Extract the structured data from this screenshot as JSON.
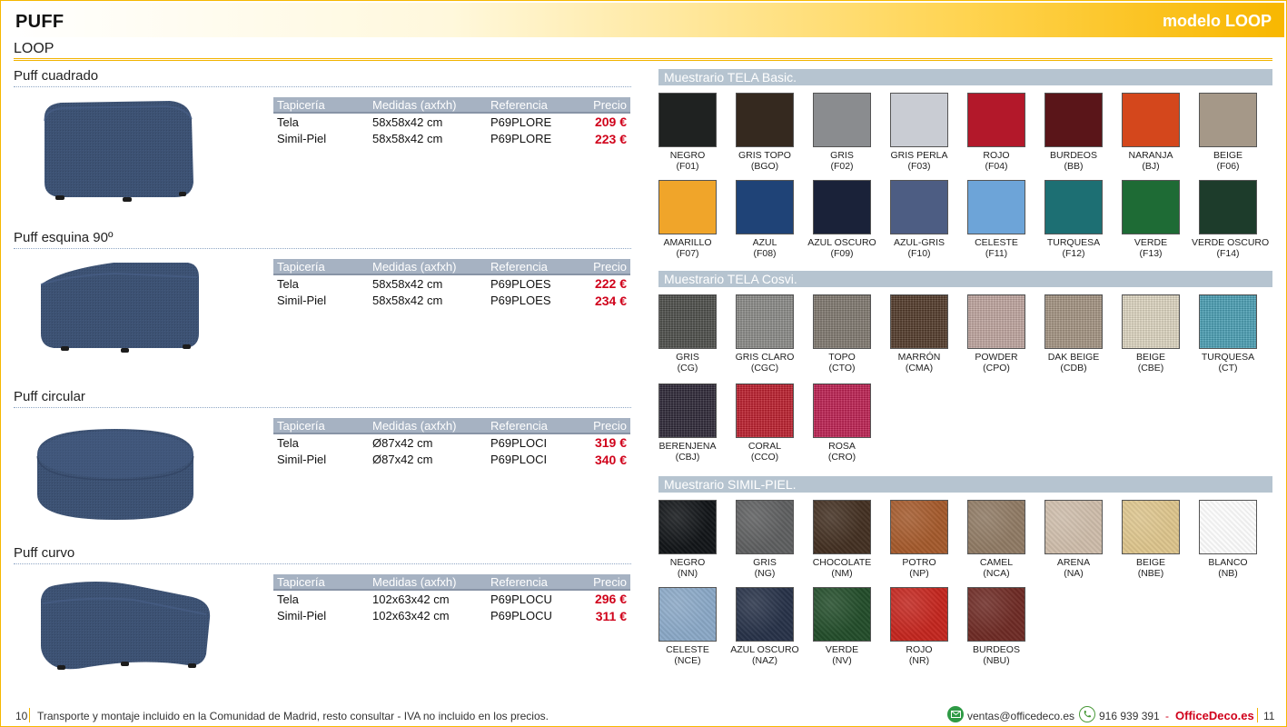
{
  "header": {
    "title": "PUFF",
    "model": "modelo LOOP",
    "subtitle": "LOOP"
  },
  "table_headers": {
    "tapiceria": "Tapicería",
    "medidas": "Medidas (axfxh)",
    "referencia": "Referencia",
    "precio": "Precio"
  },
  "products": [
    {
      "name": "Puff cuadrado",
      "shape": "square",
      "rows": [
        {
          "tapiceria": "Tela",
          "medidas": "58x58x42 cm",
          "referencia": "P69PLORE",
          "precio": "209 €"
        },
        {
          "tapiceria": "Simil-Piel",
          "medidas": "58x58x42 cm",
          "referencia": "P69PLORE",
          "precio": "223 €"
        }
      ]
    },
    {
      "name": "Puff esquina 90º",
      "shape": "corner",
      "rows": [
        {
          "tapiceria": "Tela",
          "medidas": "58x58x42 cm",
          "referencia": "P69PLOES",
          "precio": "222 €"
        },
        {
          "tapiceria": "Simil-Piel",
          "medidas": "58x58x42 cm",
          "referencia": "P69PLOES",
          "precio": "234 €"
        }
      ]
    },
    {
      "name": "Puff circular",
      "shape": "round",
      "rows": [
        {
          "tapiceria": "Tela",
          "medidas": "Ø87x42 cm",
          "referencia": "P69PLOCI",
          "precio": "319 €"
        },
        {
          "tapiceria": "Simil-Piel",
          "medidas": "Ø87x42 cm",
          "referencia": "P69PLOCI",
          "precio": "340 €"
        }
      ]
    },
    {
      "name": "Puff curvo",
      "shape": "curved",
      "rows": [
        {
          "tapiceria": "Tela",
          "medidas": "102x63x42 cm",
          "referencia": "P69PLOCU",
          "precio": "296 €"
        },
        {
          "tapiceria": "Simil-Piel",
          "medidas": "102x63x42 cm",
          "referencia": "P69PLOCU",
          "precio": "311 €"
        }
      ]
    }
  ],
  "swatch_sections": [
    {
      "title": "Muestrario TELA Basic.",
      "texture": "flat",
      "swatches": [
        {
          "name": "NEGRO",
          "code": "(F01)",
          "color": "#1f2221"
        },
        {
          "name": "GRIS TOPO",
          "code": "(BGO)",
          "color": "#35291f"
        },
        {
          "name": "GRIS",
          "code": "(F02)",
          "color": "#8a8c8f"
        },
        {
          "name": "GRIS PERLA",
          "code": "(F03)",
          "color": "#c9ccd3"
        },
        {
          "name": "ROJO",
          "code": "(F04)",
          "color": "#b3182a"
        },
        {
          "name": "BURDEOS",
          "code": "(BB)",
          "color": "#5a1519"
        },
        {
          "name": "NARANJA",
          "code": "(BJ)",
          "color": "#d4471c"
        },
        {
          "name": "BEIGE",
          "code": "(F06)",
          "color": "#a59888"
        },
        {
          "name": "AMARILLO",
          "code": "(F07)",
          "color": "#f0a52a"
        },
        {
          "name": "AZUL",
          "code": "(F08)",
          "color": "#1f4377"
        },
        {
          "name": "AZUL OSCURO",
          "code": "(F09)",
          "color": "#1a2239"
        },
        {
          "name": "AZUL-GRIS",
          "code": "(F10)",
          "color": "#4d5d83"
        },
        {
          "name": "CELESTE",
          "code": "(F11)",
          "color": "#6da4d8"
        },
        {
          "name": "TURQUESA",
          "code": "(F12)",
          "color": "#1d6f73"
        },
        {
          "name": "VERDE",
          "code": "(F13)",
          "color": "#1e6b35"
        },
        {
          "name": "VERDE OSCURO",
          "code": "(F14)",
          "color": "#1d3c2b"
        }
      ]
    },
    {
      "title": "Muestrario TELA Cosvi.",
      "texture": "tex",
      "swatches": [
        {
          "name": "GRIS",
          "code": "(CG)",
          "color": "#4d4e4a"
        },
        {
          "name": "GRIS CLARO",
          "code": "(CGC)",
          "color": "#8d8d8a"
        },
        {
          "name": "TOPO",
          "code": "(CTO)",
          "color": "#827a71"
        },
        {
          "name": "MARRÓN",
          "code": "(CMA)",
          "color": "#533a29"
        },
        {
          "name": "POWDER",
          "code": "(CPO)",
          "color": "#c4a9a3"
        },
        {
          "name": "DAK BEIGE",
          "code": "(CDB)",
          "color": "#a89784"
        },
        {
          "name": "BEIGE",
          "code": "(CBE)",
          "color": "#e4dcc6"
        },
        {
          "name": "TURQUESA",
          "code": "(CT)",
          "color": "#4ba3b8"
        },
        {
          "name": "BERENJENA",
          "code": "(CBJ)",
          "color": "#2c2636"
        },
        {
          "name": "CORAL",
          "code": "(CCO)",
          "color": "#c11d2c"
        },
        {
          "name": "ROSA",
          "code": "(CRO)",
          "color": "#c21f52"
        }
      ]
    },
    {
      "title": "Muestrario SIMIL-PIEL.",
      "texture": "leather",
      "swatches": [
        {
          "name": "NEGRO",
          "code": "(NN)",
          "color": "#121518"
        },
        {
          "name": "GRIS",
          "code": "(NG)",
          "color": "#5e5f60"
        },
        {
          "name": "CHOCOLATE",
          "code": "(NM)",
          "color": "#433022"
        },
        {
          "name": "POTRO",
          "code": "(NP)",
          "color": "#a45a2c"
        },
        {
          "name": "CAMEL",
          "code": "(NCA)",
          "color": "#8f7a64"
        },
        {
          "name": "ARENA",
          "code": "(NA)",
          "color": "#cdbcaa"
        },
        {
          "name": "BEIGE",
          "code": "(NBE)",
          "color": "#dcc48c"
        },
        {
          "name": "BLANCO",
          "code": "(NB)",
          "color": "#fbfbfb"
        },
        {
          "name": "CELESTE",
          "code": "(NCE)",
          "color": "#8aa8c6"
        },
        {
          "name": "AZUL OSCURO",
          "code": "(NAZ)",
          "color": "#273248"
        },
        {
          "name": "VERDE",
          "code": "(NV)",
          "color": "#234d2a"
        },
        {
          "name": "ROJO",
          "code": "(NR)",
          "color": "#c3261f"
        },
        {
          "name": "BURDEOS",
          "code": "(NBU)",
          "color": "#6e2b25"
        }
      ]
    }
  ],
  "footer": {
    "page_left": "10",
    "note": "Transporte y montaje incluido en la Comunidad de Madrid, resto consultar - IVA no incluido en los precios.",
    "email": "ventas@officedeco.es",
    "phone": "916 939 391",
    "separator": "-",
    "site": "OfficeDeco.es",
    "page_right": "11"
  },
  "colors": {
    "accent": "#f5b800",
    "price_red": "#d0021b",
    "table_header": "#a6b2c2",
    "section_bar": "#b6c4d0",
    "upholstery_blue": "#3d5273",
    "email_green": "#2e9a45",
    "phone_green": "#4a9a3a"
  }
}
